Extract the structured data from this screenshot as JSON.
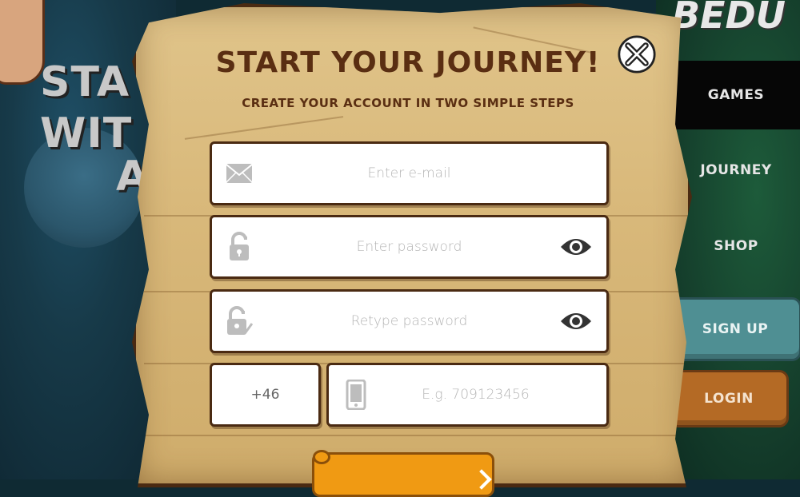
{
  "background": {
    "hero_lines": [
      "STA",
      "WIT",
      "A"
    ],
    "logo_text": "BEDU"
  },
  "nav": {
    "games": "GAMES",
    "journey": "JOURNEY",
    "shop": "SHOP",
    "signup": "SIGN UP",
    "login": "LOGIN"
  },
  "modal": {
    "title": "START YOUR JOURNEY!",
    "subtitle": "CREATE YOUR ACCOUNT IN TWO SIMPLE STEPS",
    "close_icon": "close-x-icon"
  },
  "form": {
    "email": {
      "placeholder": "Enter e-mail",
      "icon": "envelope-icon"
    },
    "password": {
      "placeholder": "Enter password",
      "icon": "padlock-icon"
    },
    "retype_password": {
      "placeholder": "Retype password",
      "icon": "padlock-check-icon"
    },
    "country_code": {
      "value": "+46"
    },
    "phone": {
      "placeholder": "E.g. 709123456",
      "icon": "phone-icon"
    }
  },
  "colors": {
    "parchment": "#d9b97b",
    "ink": "#5a2e12",
    "signup_teal": "#4f8f93",
    "login_orange": "#b46a25",
    "submit_orange": "#f09a13"
  }
}
